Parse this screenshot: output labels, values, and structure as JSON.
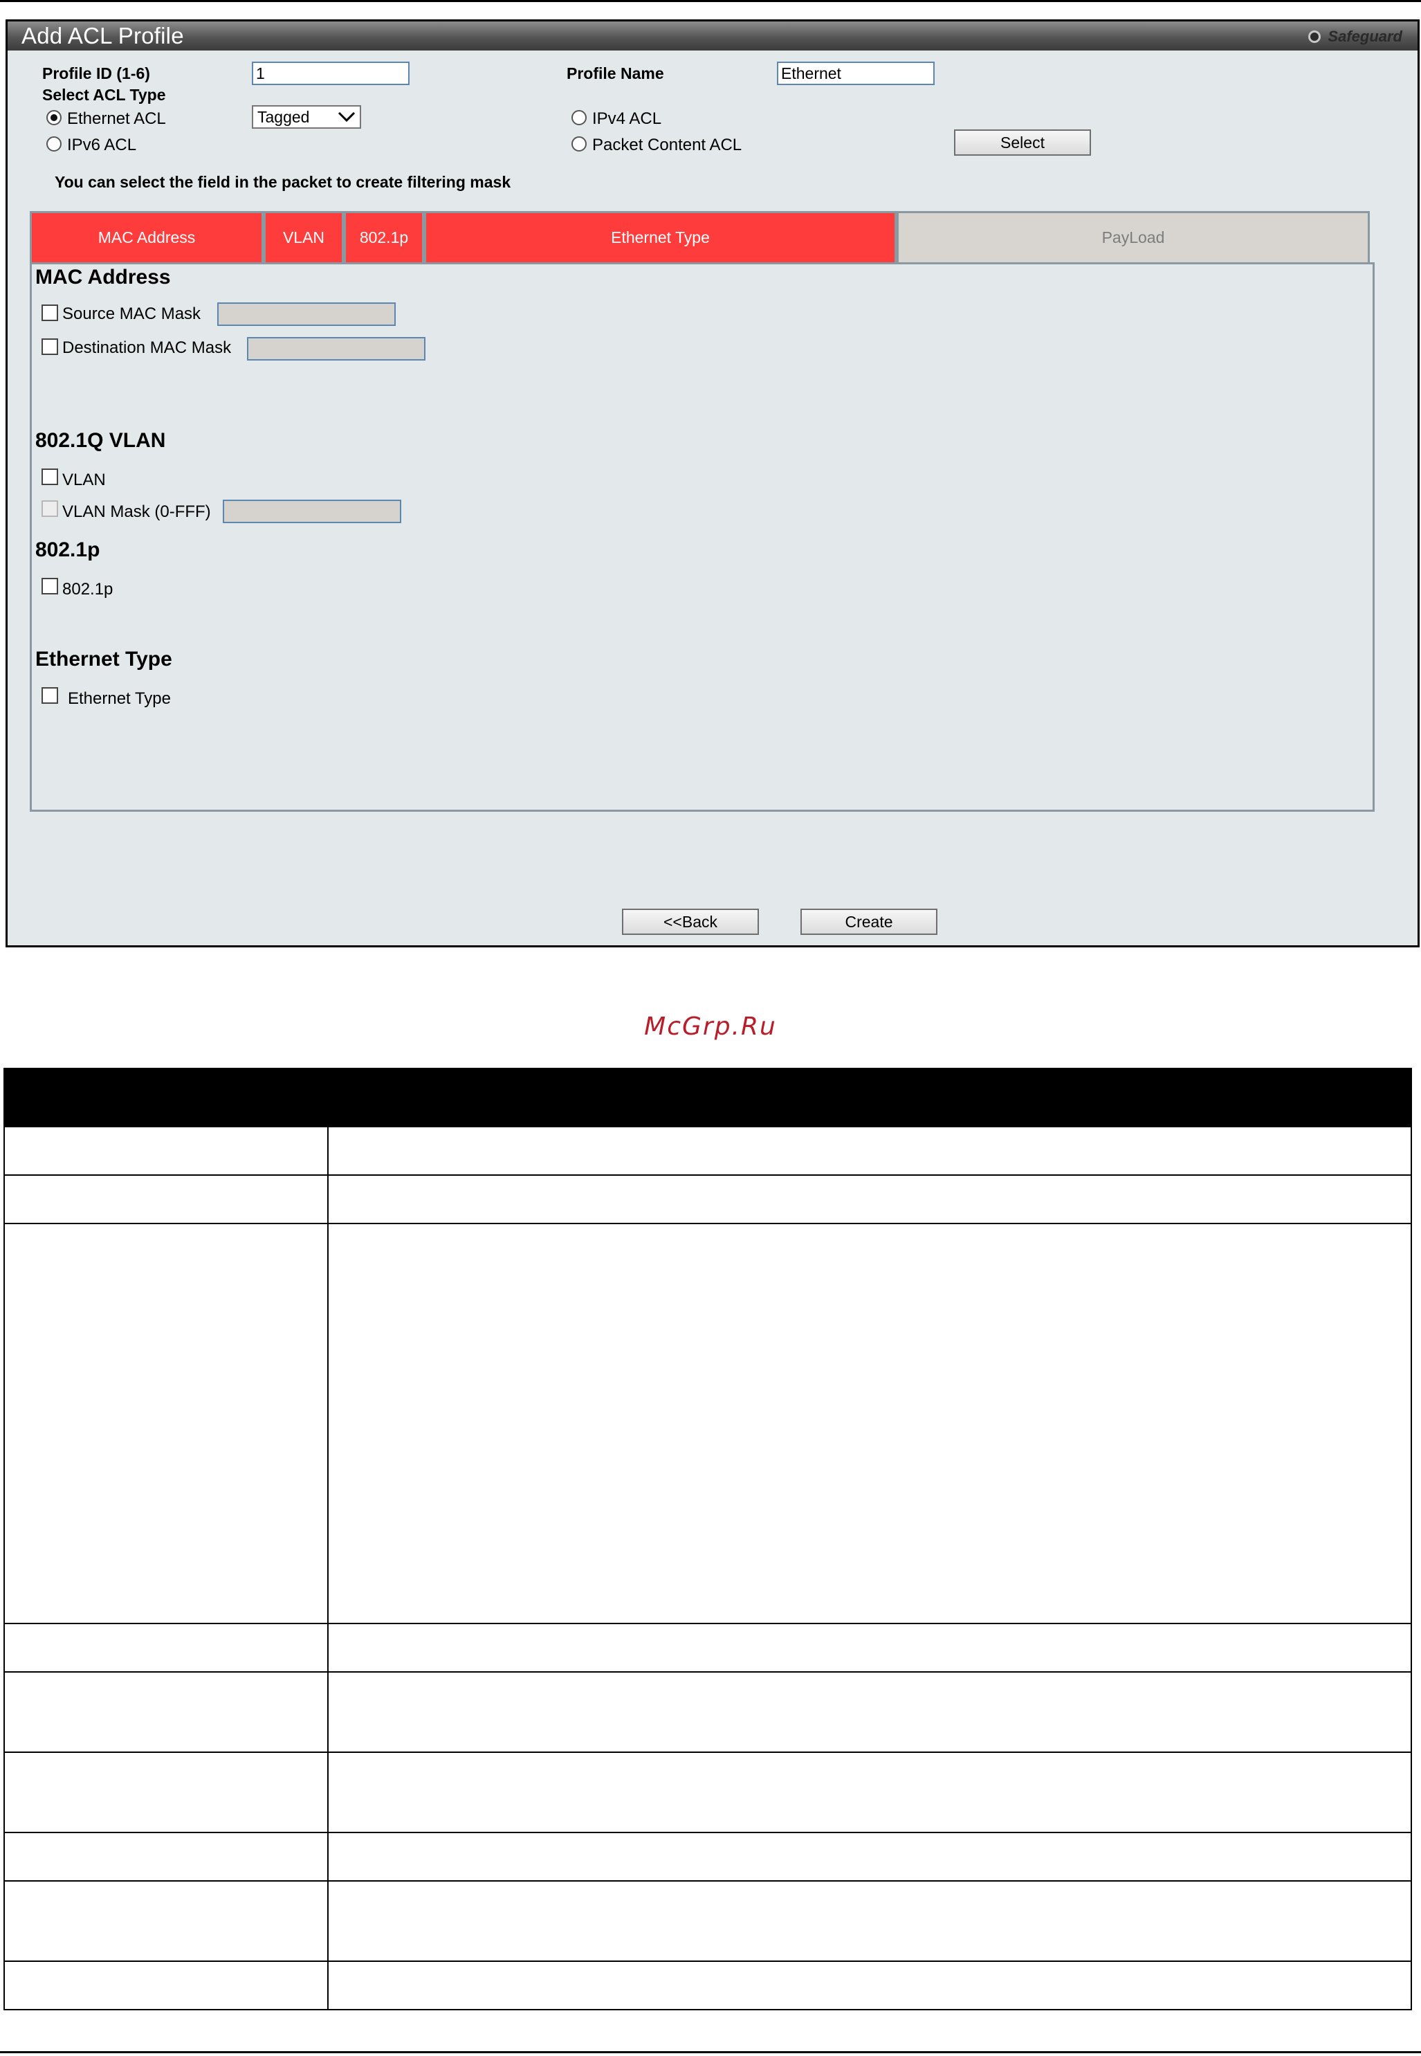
{
  "window": {
    "title": "Add ACL Profile",
    "safeguard_label": "Safeguard"
  },
  "form": {
    "profile_id_label": "Profile ID (1-6)",
    "profile_id_value": "1",
    "profile_name_label": "Profile Name",
    "profile_name_value": "Ethernet",
    "select_acl_type_label": "Select ACL Type",
    "acl_types": [
      {
        "label": "Ethernet ACL",
        "selected": true
      },
      {
        "label": "IPv4 ACL",
        "selected": false
      },
      {
        "label": "IPv6 ACL",
        "selected": false
      },
      {
        "label": "Packet Content ACL",
        "selected": false
      }
    ],
    "tag_select_value": "Tagged",
    "select_button": "Select",
    "hint": "You can select the field in the packet to create filtering mask"
  },
  "tabs": [
    {
      "label": "MAC Address",
      "active": true
    },
    {
      "label": "VLAN",
      "active": true
    },
    {
      "label": "802.1p",
      "active": true
    },
    {
      "label": "Ethernet Type",
      "active": true
    },
    {
      "label": "PayLoad",
      "active": false
    }
  ],
  "sections": {
    "mac": {
      "title": "MAC Address",
      "source_mac_mask": "Source MAC Mask",
      "destination_mac_mask": "Destination MAC Mask"
    },
    "vlan": {
      "title": "802.1Q VLAN",
      "vlan": "VLAN",
      "vlan_mask": "VLAN Mask (0-FFF)"
    },
    "dot1p": {
      "title": "802.1p",
      "dot1p": "802.1p"
    },
    "ethertype": {
      "title": "Ethernet Type",
      "ethertype": "Ethernet Type"
    }
  },
  "buttons": {
    "back": "<<Back",
    "create": "Create"
  },
  "watermark": "McGrp.Ru",
  "colors": {
    "active_tab": "#ff3c3c",
    "inactive_tab": "#d8d4cf",
    "panel_bg": "#e3e8ea",
    "watermark": "#b81e2a"
  }
}
